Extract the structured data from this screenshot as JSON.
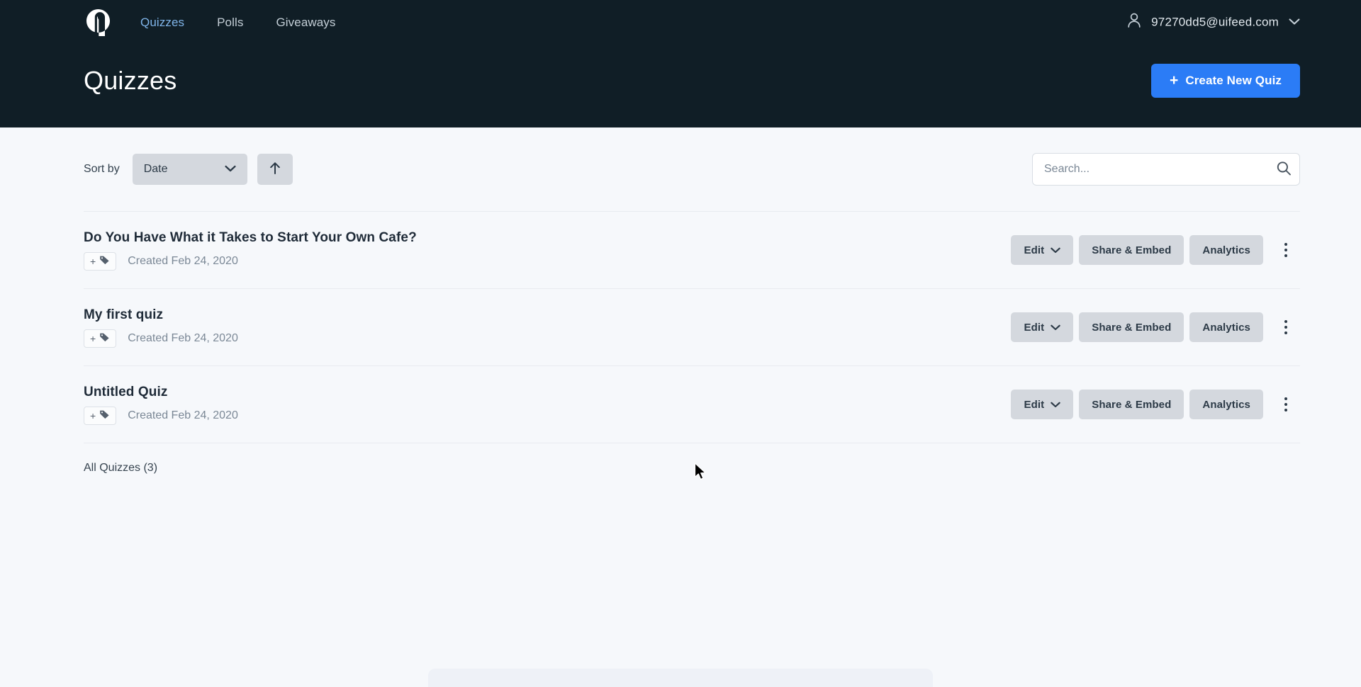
{
  "theme": {
    "header_bg": "#101e26",
    "body_bg": "#f6f8fb",
    "accent": "#2b7cf6",
    "nav_active": "#7fb4e8",
    "button_gray": "#d4d8de",
    "divider": "#e8ebf0"
  },
  "header": {
    "logo_name": "brand-logo",
    "nav": [
      {
        "label": "Quizzes",
        "active": true
      },
      {
        "label": "Polls",
        "active": false
      },
      {
        "label": "Giveaways",
        "active": false
      }
    ],
    "account": {
      "icon": "person-icon",
      "email": "97270dd5@uifeed.com",
      "caret": "chevron-down-icon"
    },
    "page_title": "Quizzes",
    "create_button": {
      "icon": "plus-icon",
      "plus": "+",
      "label": "Create New Quiz"
    }
  },
  "toolbar": {
    "sort_label": "Sort by",
    "sort_value": "Date",
    "sort_options": [
      "Date"
    ],
    "sort_caret": "chevron-down-icon",
    "sort_direction_icon": "arrow-up-icon",
    "search_placeholder": "Search...",
    "search_value": "",
    "search_icon": "search-icon"
  },
  "quiz_list": {
    "row_actions": {
      "edit_label": "Edit",
      "edit_caret": "chevron-down-icon",
      "share_label": "Share & Embed",
      "analytics_label": "Analytics",
      "more_icon": "kebab-menu-icon"
    },
    "tag_button": {
      "plus": "+",
      "icon": "tag-icon"
    },
    "rows": [
      {
        "title": "Do You Have What it Takes to Start Your Own Cafe?",
        "created": "Created Feb 24, 2020"
      },
      {
        "title": "My first quiz",
        "created": "Created Feb 24, 2020"
      },
      {
        "title": "Untitled Quiz",
        "created": "Created Feb 24, 2020"
      }
    ],
    "footer": "All Quizzes (3)"
  }
}
